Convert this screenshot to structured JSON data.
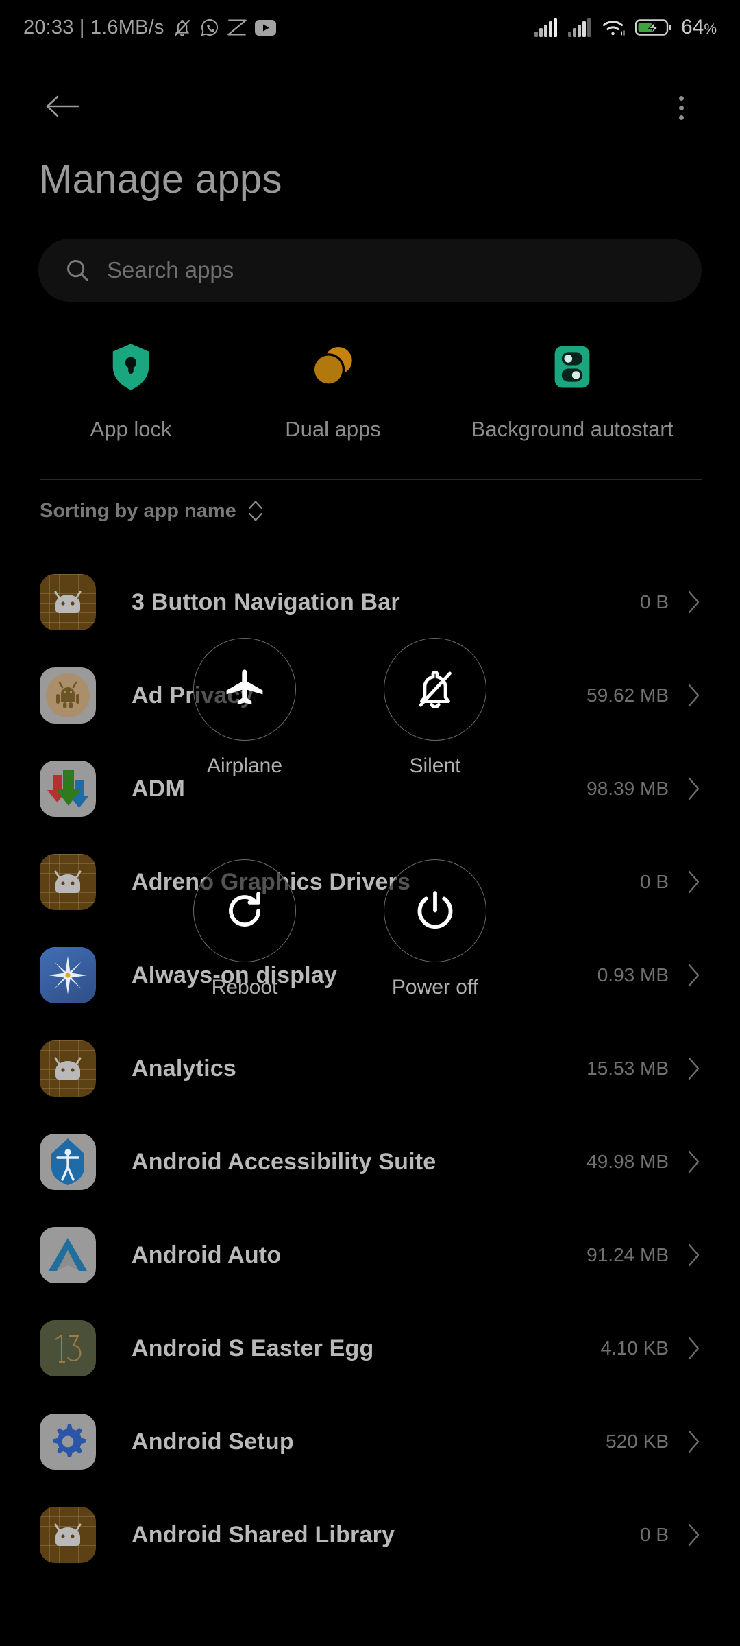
{
  "statusbar": {
    "clock": "20:33 | 1.6MB/s",
    "left_icons": [
      "notification-silenced-icon",
      "whatsapp-icon",
      "snapchat-icon",
      "youtube-icon"
    ],
    "right_icons": [
      "signal-sim1-icon",
      "signal-sim2-icon",
      "wifi-icon",
      "battery-charging-icon"
    ],
    "battery_percent": "64",
    "battery_percent_symbol": "%"
  },
  "appbar": {
    "back_icon": "arrow-left-icon",
    "overflow_icon": "more-vertical-icon"
  },
  "header": {
    "title": "Manage apps"
  },
  "search": {
    "icon": "search-icon",
    "placeholder": "Search apps"
  },
  "quick_actions": [
    {
      "label": "App lock",
      "icon": "shield-lock-icon",
      "color": "#1aa77f"
    },
    {
      "label": "Dual apps",
      "icon": "dual-circles-icon",
      "color": "#c5820e"
    },
    {
      "label": "Background autostart",
      "icon": "autostart-toggle-icon",
      "color": "#1aa77f"
    }
  ],
  "sorting": {
    "label": "Sorting by app name",
    "icon": "sort-updown-icon"
  },
  "apps": [
    {
      "name": "3 Button Navigation Bar",
      "size": "0 B",
      "icon": "android-grid-icon"
    },
    {
      "name": "Ad Privacy",
      "size": "59.62 MB",
      "icon": "ad-privacy-icon"
    },
    {
      "name": "ADM",
      "size": "98.39 MB",
      "icon": "adm-arrows-icon"
    },
    {
      "name": "Adreno Graphics Drivers",
      "size": "0 B",
      "icon": "android-grid-icon"
    },
    {
      "name": "Always-on display",
      "size": "0.93 MB",
      "icon": "always-on-display-icon"
    },
    {
      "name": "Analytics",
      "size": "15.53 MB",
      "icon": "android-grid-icon"
    },
    {
      "name": "Android Accessibility Suite",
      "size": "49.98 MB",
      "icon": "accessibility-icon"
    },
    {
      "name": "Android Auto",
      "size": "91.24 MB",
      "icon": "android-auto-icon"
    },
    {
      "name": "Android S Easter Egg",
      "size": "4.10 KB",
      "icon": "easter-egg-13-icon"
    },
    {
      "name": "Android Setup",
      "size": "520 KB",
      "icon": "android-setup-gear-icon"
    },
    {
      "name": "Android Shared Library",
      "size": "0 B",
      "icon": "android-grid-icon"
    }
  ],
  "power_menu": [
    {
      "key": "airplane",
      "label": "Airplane",
      "icon": "airplane-icon"
    },
    {
      "key": "silent",
      "label": "Silent",
      "icon": "bell-slash-icon"
    },
    {
      "key": "reboot",
      "label": "Reboot",
      "icon": "restart-icon"
    },
    {
      "key": "poweroff",
      "label": "Power off",
      "icon": "power-icon"
    }
  ]
}
